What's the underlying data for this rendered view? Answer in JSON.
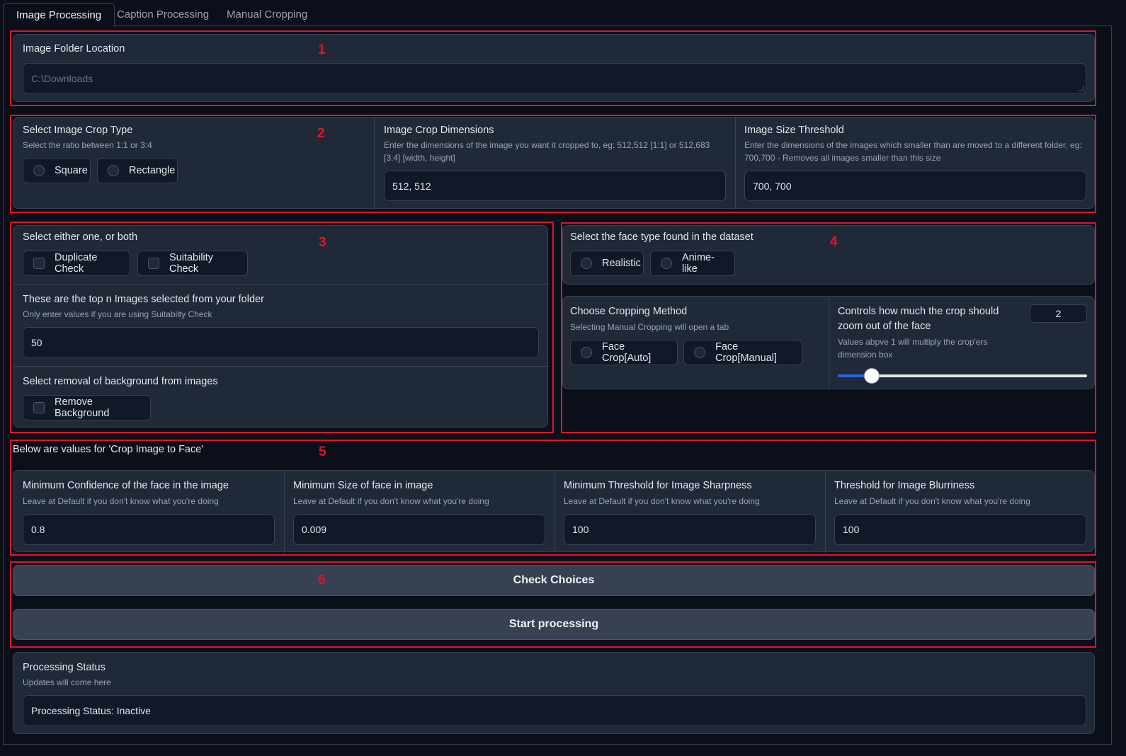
{
  "tabs": [
    {
      "label": "Image Processing",
      "active": true
    },
    {
      "label": "Caption Processing",
      "active": false
    },
    {
      "label": "Manual Cropping",
      "active": false
    }
  ],
  "markers": [
    "1",
    "2",
    "3",
    "4",
    "5",
    "6"
  ],
  "section1": {
    "label": "Image Folder Location",
    "placeholder": "C:\\Downloads"
  },
  "section2": {
    "crop_type": {
      "label": "Select Image Crop Type",
      "info": "Select the ratio between 1:1 or 3:4",
      "options": [
        "Square",
        "Rectangle"
      ]
    },
    "crop_dims": {
      "label": "Image Crop Dimensions",
      "info": "Enter the dimensions of the image you want it cropped to, eg: 512,512 [1:1] or 512,683 [3:4] [width, height]",
      "value": "512, 512"
    },
    "size_threshold": {
      "label": "Image Size Threshold",
      "info": "Enter the dimensions of the images which smaller than are moved to a different folder, eg: 700,700 - Removes all images smaller than this size",
      "value": "700, 700"
    }
  },
  "section3": {
    "checks": {
      "label": "Select either one, or both",
      "options": [
        "Duplicate Check",
        "Suitability Check"
      ]
    },
    "top_n": {
      "label": "These are the top n Images selected from your folder",
      "info": "Only enter values if you are using Suitabilty Check",
      "value": "50"
    },
    "background": {
      "label": "Select removal of background from images",
      "option": "Remove Background"
    }
  },
  "section4": {
    "face_type": {
      "label": "Select the face type found in the dataset",
      "options": [
        "Realistic",
        "Anime-like"
      ]
    },
    "crop_method": {
      "label": "Choose Cropping Method",
      "info": "Selecting Manual Cropping will open a tab",
      "options": [
        "Face Crop[Auto]",
        "Face Crop[Manual]"
      ]
    },
    "zoom": {
      "label": "Controls how much the crop should zoom out of the face",
      "info": "Values abpve 1 will multiply the crop'ers dimension box",
      "value": "2",
      "slider_fraction": 0.135
    }
  },
  "section5": {
    "title": "Below are values for 'Crop Image to Face'",
    "fields": [
      {
        "label": "Minimum Confidence of the face in the image",
        "info": "Leave at Default if you don't know what you're doing",
        "value": "0.8"
      },
      {
        "label": "Minimum Size of face in image",
        "info": "Leave at Default if you don't know what you're doing",
        "value": "0.009"
      },
      {
        "label": "Minimum Threshold for Image Sharpness",
        "info": "Leave at Default if you don't know what you're doing",
        "value": "100"
      },
      {
        "label": "Threshold for Image Blurriness",
        "info": "Leave at Default if you don't know what you're doing",
        "value": "100"
      }
    ]
  },
  "section6": {
    "check_label": "Check Choices",
    "start_label": "Start processing"
  },
  "status": {
    "label": "Processing Status",
    "info": "Updates will come here",
    "value": "Processing Status: Inactive"
  },
  "colors": {
    "background": "#0b0f19",
    "panel": "#1f2937",
    "input": "#111827",
    "highlight": "#e0142c",
    "slider": "#2563eb"
  }
}
